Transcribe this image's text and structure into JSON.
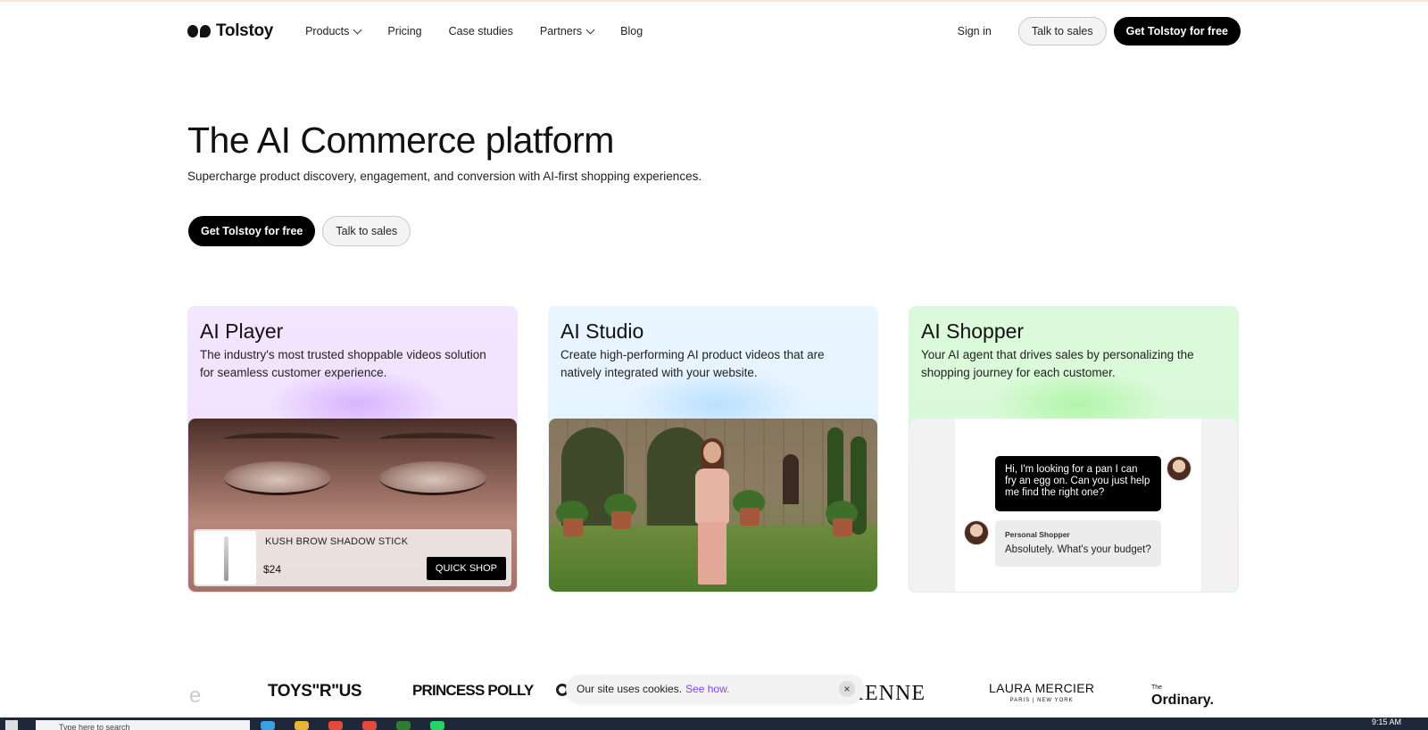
{
  "nav": {
    "brand": "Tolstoy",
    "links": [
      {
        "label": "Products",
        "dropdown": true
      },
      {
        "label": "Pricing",
        "dropdown": false
      },
      {
        "label": "Case studies",
        "dropdown": false
      },
      {
        "label": "Partners",
        "dropdown": true
      },
      {
        "label": "Blog",
        "dropdown": false
      }
    ],
    "sign_in": "Sign in",
    "talk_to_sales": "Talk to sales",
    "get_free": "Get Tolstoy for free"
  },
  "hero": {
    "title": "The AI Commerce platform",
    "subtitle": "Supercharge product discovery, engagement, and conversion with AI-first shopping experiences.",
    "primary_cta": "Get Tolstoy for free",
    "secondary_cta": "Talk to sales"
  },
  "cards": [
    {
      "title": "AI Player",
      "description": "The industry's most trusted shoppable videos solution for seamless customer experience.",
      "product_name": "KUSH BROW SHADOW STICK",
      "price": "$24",
      "quick_shop": "QUICK SHOP"
    },
    {
      "title": "AI Studio",
      "description": "Create high-performing AI product videos that are natively integrated with your website."
    },
    {
      "title": "AI Shopper",
      "description": "Your AI agent that drives sales by personalizing the shopping journey for each customer.",
      "user_message": "Hi, I'm looking for a pan I can fry an egg on. Can you just help me find the right one?",
      "bot_name": "Personal Shopper",
      "bot_message": "Absolutely. What's your budget?"
    }
  ],
  "logos": {
    "partial_left": "e",
    "toys": "TOYS\"R\"US",
    "polly": "PRINCESS POLLY",
    "enne": "IENNE",
    "laura": "LAURA MERCIER",
    "laura_sub": "PARIS | NEW YORK",
    "ordinary_top": "The",
    "ordinary": "Ordinary."
  },
  "cookie": {
    "text": "Our site uses cookies.",
    "link": "See how.",
    "close": "×"
  },
  "taskbar": {
    "search_placeholder": "Type here to search",
    "clock": "9:15 AM"
  },
  "colors": {
    "primary": "#000000",
    "card_player_bg": "#f3e6ff",
    "card_studio_bg": "#e9f5ff",
    "card_shopper_bg": "#dcfadb",
    "cookie_link": "#8b3dff"
  }
}
